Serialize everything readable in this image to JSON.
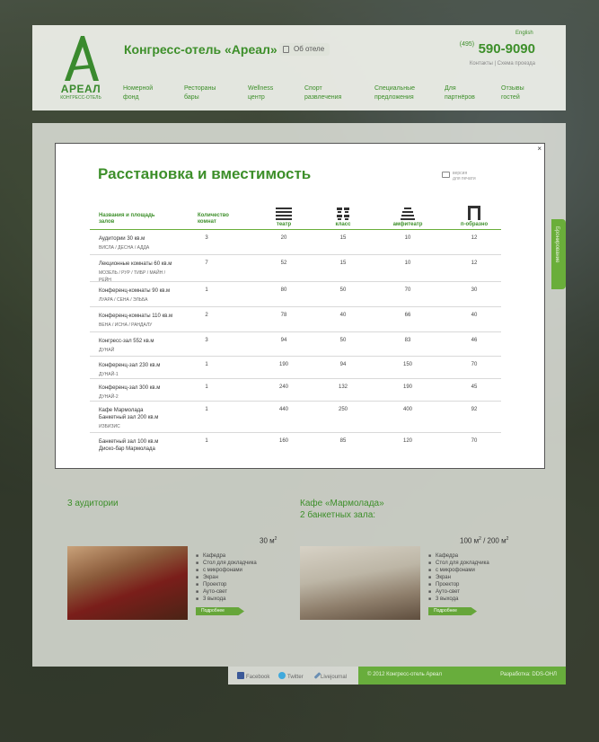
{
  "header": {
    "hotel_title": "Конгресс-отель «Ареал»",
    "about_label": "Об отеле",
    "lang_label": "English",
    "phone_code": "(495)",
    "phone_number": "590-9090",
    "contacts_label": "Контакты  |  Схема проезда",
    "logo_word": "АРЕАЛ",
    "logo_sub": "КОНГРЕСС-ОТЕЛЬ",
    "nav": [
      {
        "line1": "Номерной",
        "line2": "фонд"
      },
      {
        "line1": "Рестораны",
        "line2": "бары"
      },
      {
        "line1": "Wellness",
        "line2": "центр"
      },
      {
        "line1": "Спорт",
        "line2": "развлечения"
      },
      {
        "line1": "Специальные",
        "line2": "предложения"
      },
      {
        "line1": "Для",
        "line2": "партнёров"
      },
      {
        "line1": "Отзывы",
        "line2": "гостей"
      }
    ]
  },
  "modal": {
    "title": "Расстановка и вместимость",
    "close_label": "×",
    "print_label_1": "версия",
    "print_label_2": "для печати",
    "columns": {
      "name": [
        "Названия и площадь",
        "залов"
      ],
      "count": [
        "Количество",
        "комнат"
      ],
      "theater": "театр",
      "class": "класс",
      "amphi": "амфитеатр",
      "ushape": "п-образно"
    },
    "rows": [
      {
        "name": "Аудитории 30 кв.м",
        "sub": "ВИСЛА  /  ДЕСНА  /  АДДА",
        "count": "3",
        "theater": "20",
        "class": "15",
        "amphi": "10",
        "ushape": "12"
      },
      {
        "name": "Лекционные комнаты  60 кв.м",
        "sub": "МОЗЕЛЬ  /  РУР  /  ТИБР  /  МАЙН  /",
        "sub2": "РЕЙН",
        "count": "7",
        "theater": "52",
        "class": "15",
        "amphi": "10",
        "ushape": "12"
      },
      {
        "name": "Конференц-комнаты 90 кв.м",
        "sub": "ЛУАРА  /  СЕНА  /  ЭЛЬБА",
        "count": "1",
        "theater": "80",
        "class": "50",
        "amphi": "70",
        "ushape": "30"
      },
      {
        "name": "Конференц-комнаты 110 кв.м",
        "sub": "ВЕНА  /  ИСНА  /  РАНДАЛУ",
        "count": "2",
        "theater": "78",
        "class": "40",
        "amphi": "66",
        "ushape": "40"
      },
      {
        "name": "Конгресс-зал 552 кв.м",
        "sub": "ДУНАЙ",
        "count": "3",
        "theater": "94",
        "class": "50",
        "amphi": "83",
        "ushape": "46"
      },
      {
        "name": "Конференц-зал 230 кв.м",
        "sub": "ДУНАЙ-1",
        "count": "1",
        "theater": "190",
        "class": "94",
        "amphi": "150",
        "ushape": "70"
      },
      {
        "name": "Конференц-зал 300 кв.м",
        "sub": "ДУНАЙ-2",
        "count": "1",
        "theater": "240",
        "class": "132",
        "amphi": "190",
        "ushape": "45"
      },
      {
        "name": "Кафе Мармолада",
        "name2": "Банкетный зал 200 кв.м",
        "sub": "ИЗБИЗИС",
        "count": "1",
        "theater": "440",
        "class": "250",
        "amphi": "400",
        "ushape": "92"
      },
      {
        "name": "Банкетный зал 100 кв.м",
        "name2": "Диско-бар Мармолада",
        "sub": "",
        "count": "1",
        "theater": "160",
        "class": "85",
        "amphi": "120",
        "ushape": "70"
      }
    ]
  },
  "content": {
    "left": {
      "title": "3 аудитории",
      "area": "30 м",
      "area_sup": "2",
      "features": [
        "Кафедра",
        "Стол для докладчика",
        "с микрофонами",
        "Экран",
        "Проектор",
        "Ауто-свет",
        "3 выхода"
      ],
      "more": "Подробнее"
    },
    "right": {
      "title_1": "Кафе «Мармолада»",
      "title_2": "2 банкетных зала:",
      "area_a": "100 м",
      "area_a_sup": "2",
      "area_b": " / 200 м",
      "area_b_sup": "2",
      "features": [
        "Кафедра",
        "Стол для докладчика",
        "с микрофонами",
        "Экран",
        "Проектор",
        "Ауто-свет",
        "3 выхода"
      ],
      "more": "Подробнее"
    }
  },
  "side_tab": "Бронирование",
  "footer": {
    "facebook": "Facebook",
    "twitter": "Twitter",
    "livejournal": "Livejournal",
    "copyright": "© 2012 Конгресс-отель Ареал",
    "developer": "Разработка: DDS-ОНЛ"
  },
  "colors": {
    "brand_green": "#3d8f2a",
    "accent_green": "#6aae3a"
  }
}
